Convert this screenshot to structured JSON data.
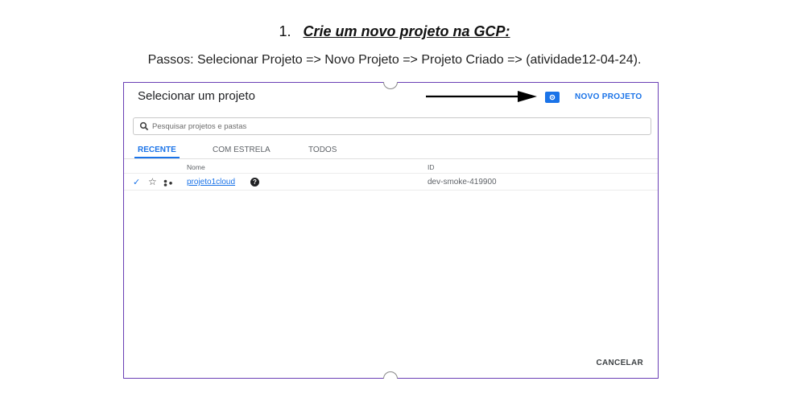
{
  "heading": {
    "number": "1.",
    "title": "Crie um novo projeto na GCP:"
  },
  "steps_text": "Passos: Selecionar Projeto => Novo Projeto => Projeto Criado => (atividade12-04-24).",
  "dialog": {
    "title": "Selecionar um projeto",
    "new_project_label": "NOVO PROJETO",
    "search_placeholder": "Pesquisar projetos e pastas",
    "tabs": [
      {
        "label": "RECENTE",
        "active": true
      },
      {
        "label": "COM ESTRELA",
        "active": false
      },
      {
        "label": "TODOS",
        "active": false
      }
    ],
    "columns": {
      "name": "Nome",
      "id": "ID"
    },
    "rows": [
      {
        "name": "projeto1cloud",
        "id": "dev-smoke-419900",
        "selected": true,
        "starred": false
      }
    ],
    "cancel_label": "CANCELAR"
  },
  "colors": {
    "accent": "#1a73e8",
    "dialog_border": "#6a3fb5"
  },
  "icons": [
    "search-icon",
    "folder-icon",
    "check-icon",
    "star-icon",
    "org-icon",
    "help-icon",
    "arrow-icon"
  ]
}
